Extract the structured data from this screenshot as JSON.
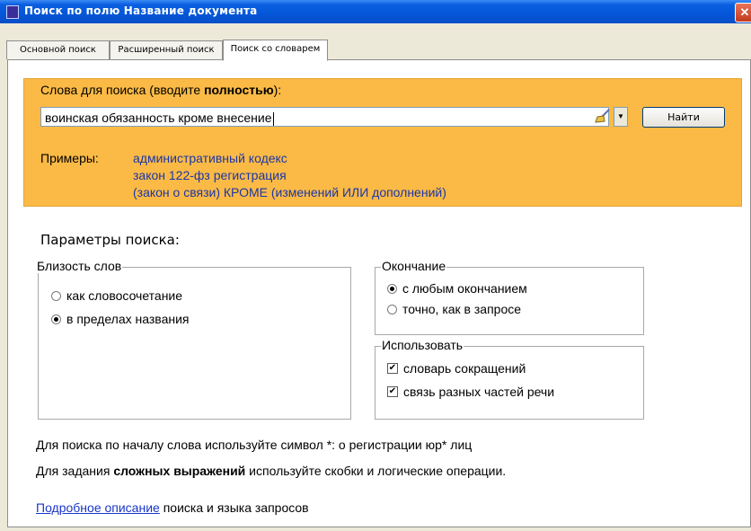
{
  "window": {
    "title": "Поиск по полю Название документа",
    "close_label": "✕"
  },
  "tabs": [
    {
      "label": "Основной поиск"
    },
    {
      "label": "Расширенный поиск"
    },
    {
      "label": "Поиск со словарем"
    }
  ],
  "search": {
    "label_start": "Слова для поиска (вводите ",
    "label_bold": "полностью",
    "label_end": "):",
    "value": "воинская обязанность кроме внесение",
    "clear_icon": "broom-icon",
    "dropdown_glyph": "▼",
    "find_label": "Найти"
  },
  "examples": {
    "label": "Примеры:",
    "items": [
      "административный кодекс",
      "закон 122-фз регистрация",
      "(закон о связи) КРОМЕ (изменений ИЛИ дополнений)"
    ]
  },
  "params": {
    "title": "Параметры поиска:",
    "proximity": {
      "legend": "Близость слов",
      "options": [
        {
          "label": "как словосочетание",
          "selected": false
        },
        {
          "label": "в пределах названия",
          "selected": true
        }
      ]
    },
    "ending": {
      "legend": "Окончание",
      "options": [
        {
          "label": "с любым окончанием",
          "selected": true
        },
        {
          "label": "точно, как в запросе",
          "selected": false
        }
      ]
    },
    "use": {
      "legend": "Использовать",
      "options": [
        {
          "label": "словарь сокращений",
          "checked": true
        },
        {
          "label": "связь разных частей речи",
          "checked": true
        }
      ]
    }
  },
  "notes": {
    "line1": "Для поиска по началу слова используйте символ *: о регистрации юр* лиц",
    "line2_start": "Для задания ",
    "line2_bold": "сложных выражений",
    "line2_end": " используйте скобки и логические операции.",
    "link_label": "Подробное описание",
    "link_after": " поиска и языка запросов"
  },
  "colors": {
    "search_bg": "#fbba45",
    "examples_text": "#1a36a8",
    "titlebar": "#0456d8"
  }
}
